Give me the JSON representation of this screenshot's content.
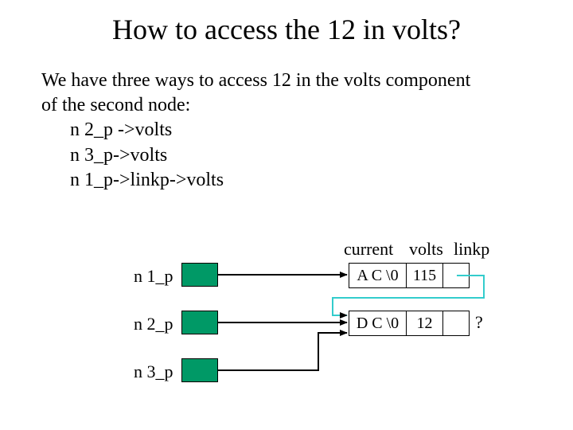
{
  "title": "How to access the 12 in volts?",
  "body": {
    "intro1": "We have three ways to access 12 in the volts component",
    "intro2": "of the second node:",
    "line1": "n 2_p ->volts",
    "line2": "n 3_p->volts",
    "line3": "n 1_p->linkp->volts"
  },
  "headers": {
    "current": "current",
    "volts": "volts",
    "linkp": "linkp"
  },
  "pointers": {
    "p1": "n 1_p",
    "p2": "n 2_p",
    "p3": "n 3_p"
  },
  "nodes": {
    "n1": {
      "current": "A C \\0",
      "volts": "115",
      "linkp": ""
    },
    "n2": {
      "current": "D C \\0",
      "volts": "12",
      "linkp": ""
    }
  },
  "question_mark": "?"
}
